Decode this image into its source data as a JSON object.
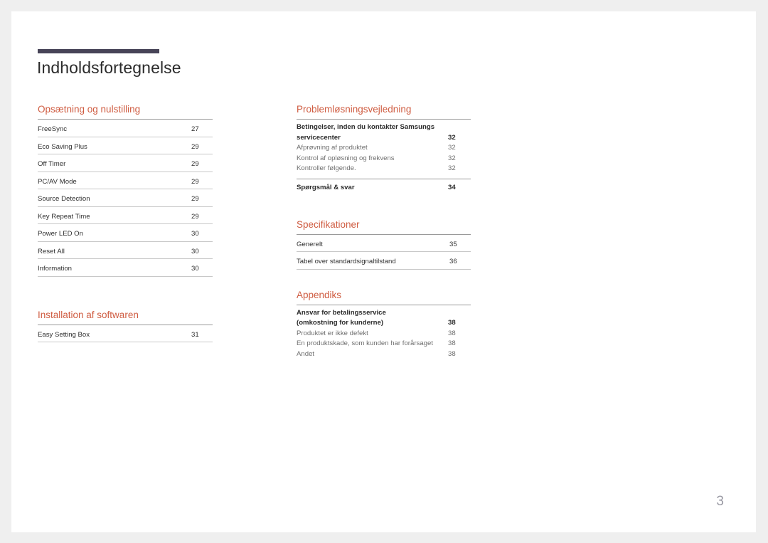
{
  "document": {
    "title": "Indholdsfortegnelse",
    "page_number": "3"
  },
  "colors": {
    "accent": "#cf5c41",
    "title_rule": "#474457",
    "title_text": "#2b2b2b",
    "rule": "#9a9a9a",
    "row_rule": "#c8c8c8",
    "page_number": "#9a9aa4",
    "sheet": "#ffffff",
    "background": "#efefef"
  },
  "left_column": {
    "sections": [
      {
        "heading": "Opsætning og nulstilling",
        "rows": [
          {
            "label": "FreeSync",
            "page": "27"
          },
          {
            "label": "Eco Saving Plus",
            "page": "29"
          },
          {
            "label": "Off Timer",
            "page": "29"
          },
          {
            "label": "PC/AV Mode",
            "page": "29"
          },
          {
            "label": "Source Detection",
            "page": "29"
          },
          {
            "label": "Key Repeat Time",
            "page": "29"
          },
          {
            "label": "Power LED On",
            "page": "30"
          },
          {
            "label": "Reset All",
            "page": "30"
          },
          {
            "label": "Information",
            "page": "30"
          }
        ]
      },
      {
        "heading": "Installation af softwaren",
        "rows": [
          {
            "label": "Easy Setting Box",
            "page": "31"
          }
        ]
      }
    ]
  },
  "right_column": {
    "sections": [
      {
        "heading": "Problemløsningsvejledning",
        "rows": [
          {
            "label": "Betingelser, inden du kontakter Samsungs",
            "page": "",
            "style": "primary"
          },
          {
            "label": "servicecenter",
            "page": "32",
            "style": "primary"
          },
          {
            "label": "Afprøvning af produktet",
            "page": "32",
            "style": "sub"
          },
          {
            "label": "Kontrol af opløsning og frekvens",
            "page": "32",
            "style": "sub"
          },
          {
            "label": "Kontroller følgende.",
            "page": "32",
            "style": "sub"
          }
        ],
        "footer_rows": [
          {
            "label": "Spørgsmål & svar",
            "page": "34",
            "style": "bold"
          }
        ]
      },
      {
        "heading": "Specifikationer",
        "table_rows": [
          {
            "label": "Generelt",
            "page": "35"
          },
          {
            "label": "Tabel over standardsignaltilstand",
            "page": "36"
          }
        ]
      },
      {
        "heading": "Appendiks",
        "rows": [
          {
            "label": "Ansvar for betalingsservice",
            "page": "",
            "style": "primary"
          },
          {
            "label": "(omkostning for kunderne)",
            "page": "38",
            "style": "primary"
          },
          {
            "label": "Produktet er ikke defekt",
            "page": "38",
            "style": "sub"
          },
          {
            "label": "En produktskade, som kunden har forårsaget",
            "page": "38",
            "style": "sub"
          },
          {
            "label": "Andet",
            "page": "38",
            "style": "sub"
          }
        ]
      }
    ]
  }
}
